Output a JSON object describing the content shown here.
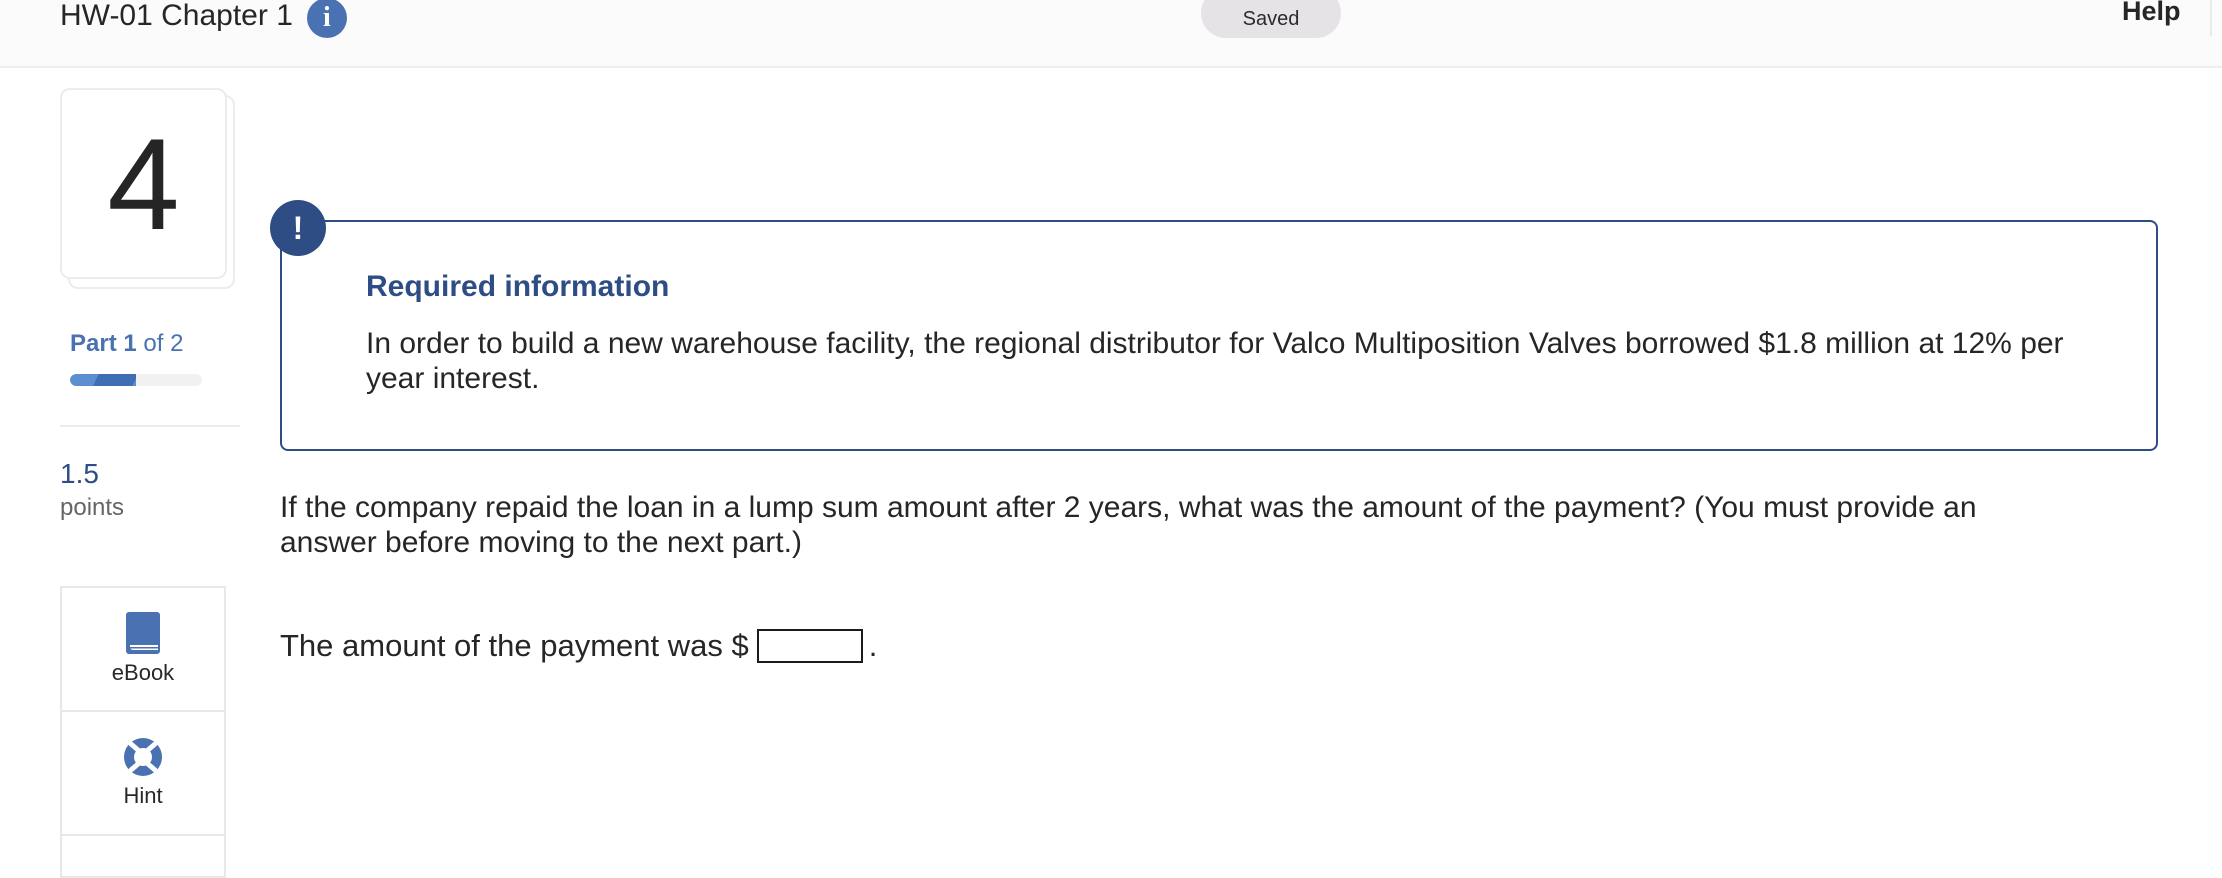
{
  "header": {
    "assignment_title": "HW-01 Chapter 1",
    "info_icon": "info-icon",
    "save_status": "Saved",
    "help_label": "Help"
  },
  "sidebar": {
    "question_number": "4",
    "part": {
      "prefix": "Part",
      "current": "1",
      "of_text": "of 2",
      "progress_fraction": 0.5
    },
    "points_value": "1.5",
    "points_label": "points",
    "tools": [
      {
        "label": "eBook",
        "icon": "book-icon"
      },
      {
        "label": "Hint",
        "icon": "lifebuoy-icon"
      }
    ]
  },
  "required_info": {
    "badge": "!",
    "title": "Required information",
    "text": "In order to build a new warehouse facility, the regional distributor for Valco Multiposition Valves borrowed $1.8 million at 12% per year interest."
  },
  "question": {
    "text": "If the company repaid the loan in a lump sum amount after 2 years, what was the amount of the payment? (You must provide an answer before moving to the next part.)",
    "answer_prefix": "The amount of the payment was $",
    "answer_value": "",
    "answer_suffix": "."
  },
  "colors": {
    "accent": "#2e4d85",
    "link_blue": "#4a72b2",
    "progress": "#3f6eb4"
  }
}
